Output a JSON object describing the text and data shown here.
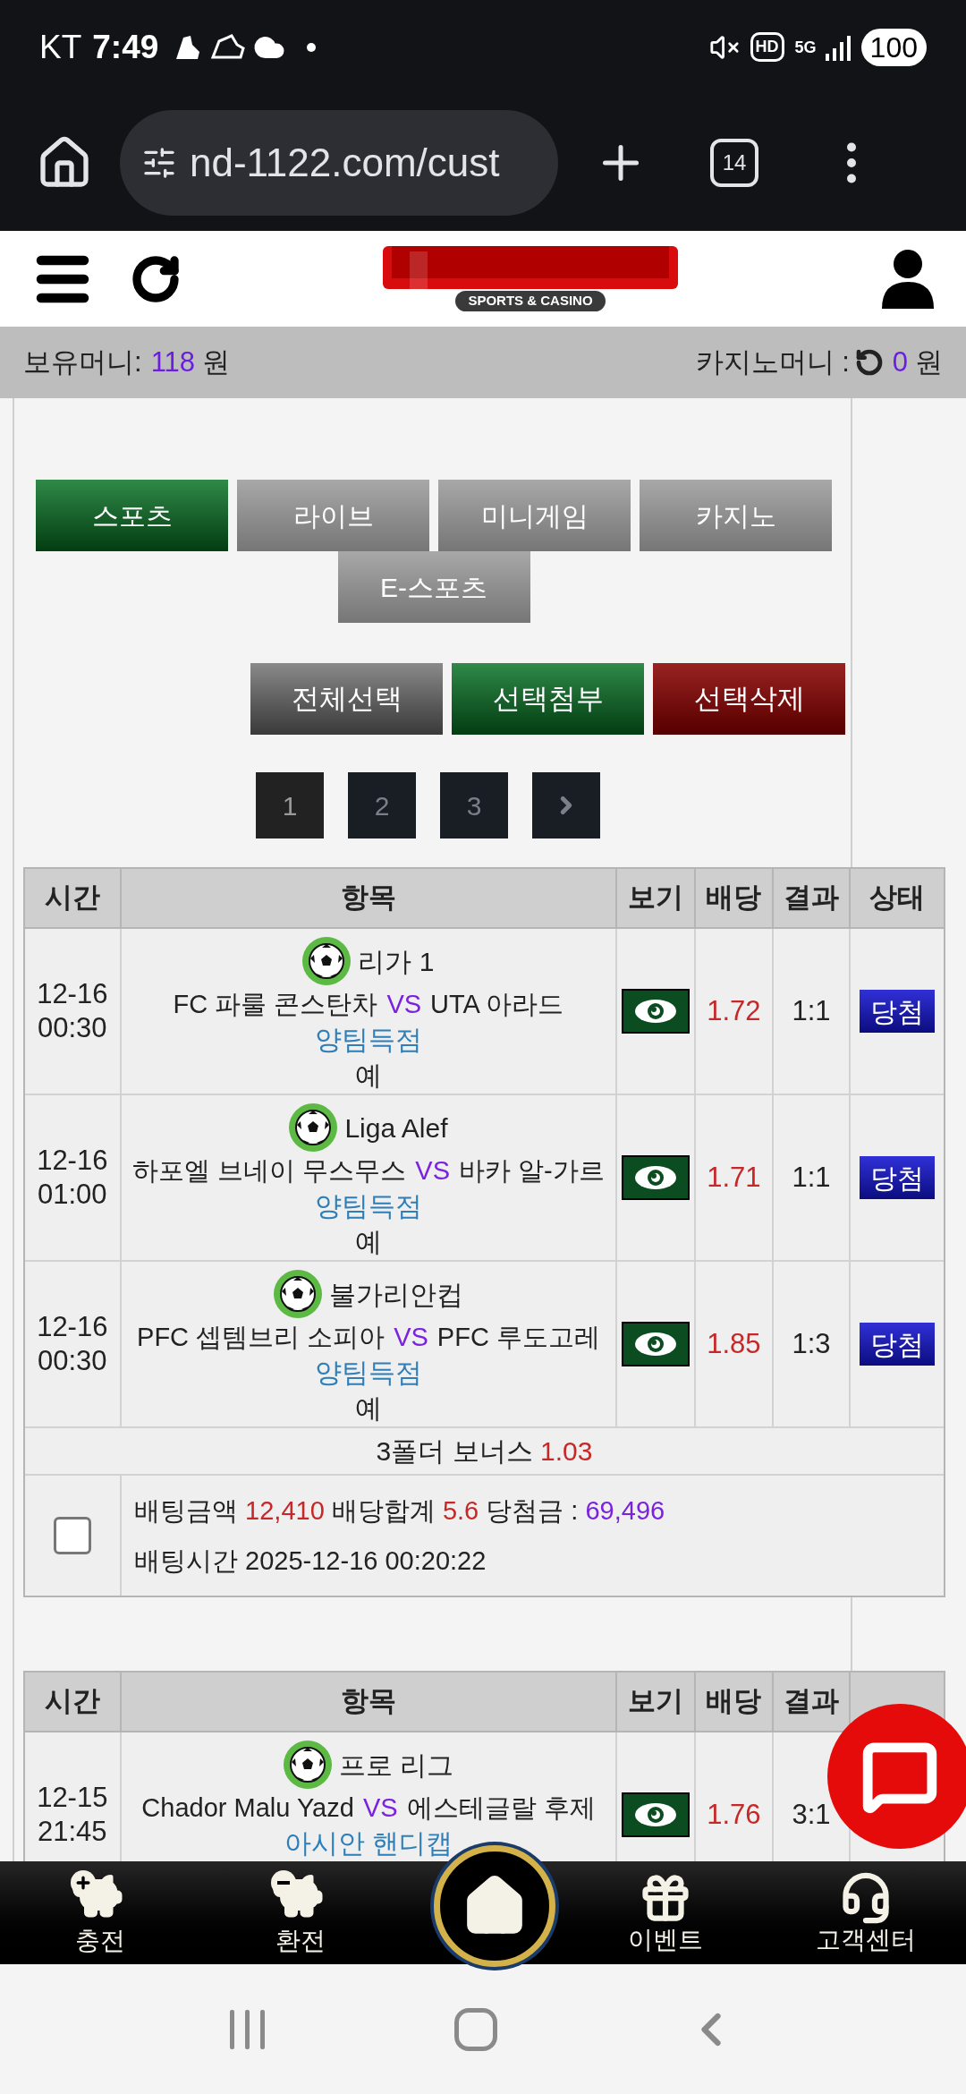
{
  "status_bar": {
    "carrier": "KT",
    "time": "7:49",
    "hd": "HD",
    "network": "5G",
    "battery": "100"
  },
  "browser": {
    "url": "nd-1122.com/cust",
    "tab_count": "14"
  },
  "site_header": {
    "logo_subtitle": "SPORTS & CASINO"
  },
  "money_bar": {
    "balance_label": "보유머니:",
    "balance": "118",
    "balance_unit": "원",
    "casino_label": "카지노머니 :",
    "casino": "0",
    "casino_unit": "원"
  },
  "tabs": [
    {
      "label": "스포츠",
      "selected": true
    },
    {
      "label": "라이브",
      "selected": false
    },
    {
      "label": "미니게임",
      "selected": false
    },
    {
      "label": "카지노",
      "selected": false
    },
    {
      "label": "E-스포츠",
      "selected": false
    }
  ],
  "actions": [
    {
      "label": "전체선택",
      "kind": "neutral"
    },
    {
      "label": "선택첨부",
      "kind": "attach"
    },
    {
      "label": "선택삭제",
      "kind": "delete"
    }
  ],
  "pagination": {
    "pages": [
      {
        "label": "1",
        "selected": true
      },
      {
        "label": "2",
        "selected": false
      },
      {
        "label": "3",
        "selected": false
      }
    ]
  },
  "bets": [
    {
      "columns": [
        "시간",
        "항목",
        "보기",
        "배당",
        "결과",
        "상태"
      ],
      "rows": [
        {
          "date": "12-16",
          "clock": "00:30",
          "league": "리가 1",
          "home": "FC 파룰 콘스탄차",
          "vs": "VS",
          "away": "UTA 아라드",
          "market": "양팀득점",
          "pick": "예",
          "odds": "1.72",
          "result": "1:1",
          "status": "당첨"
        },
        {
          "date": "12-16",
          "clock": "01:00",
          "league": "Liga Alef",
          "home": "하포엘 브네이 무스무스",
          "vs": "VS",
          "away": "바카 알-가르",
          "market": "양팀득점",
          "pick": "예",
          "odds": "1.71",
          "result": "1:1",
          "status": "당첨"
        },
        {
          "date": "12-16",
          "clock": "00:30",
          "league": "불가리안컵",
          "home": "PFC 셉템브리 소피아",
          "vs": "VS",
          "away": "PFC 루도고레",
          "market": "양팀득점",
          "pick": "예",
          "odds": "1.85",
          "result": "1:3",
          "status": "당첨"
        }
      ],
      "bonus": {
        "label": "3폴더 보너스",
        "value": "1.03"
      },
      "summary": {
        "checked": false,
        "amount_label": "배팅금액",
        "amount": "12,410",
        "odds_label": "배당합계",
        "odds": "5.6",
        "win_label": "당첨금 :",
        "win": "69,496",
        "time_label": "배팅시간",
        "time": "2025-12-16 00:20:22"
      }
    },
    {
      "columns": [
        "시간",
        "항목",
        "보기",
        "배당",
        "결과"
      ],
      "rows": [
        {
          "date": "12-15",
          "clock": "21:45",
          "league": "프로 리그",
          "home": "Chador Malu Yazd",
          "vs": "VS",
          "away": "에스테글랄 후제",
          "market": "아시안 핸디캡",
          "odds": "1.76",
          "result": "3:1"
        }
      ]
    }
  ],
  "bottom_nav": [
    {
      "label": "충전",
      "kind": "deposit"
    },
    {
      "label": "환전",
      "kind": "withdraw"
    },
    {
      "kind": "home"
    },
    {
      "label": "이벤트",
      "kind": "event"
    },
    {
      "label": "고객센터",
      "kind": "support"
    }
  ]
}
